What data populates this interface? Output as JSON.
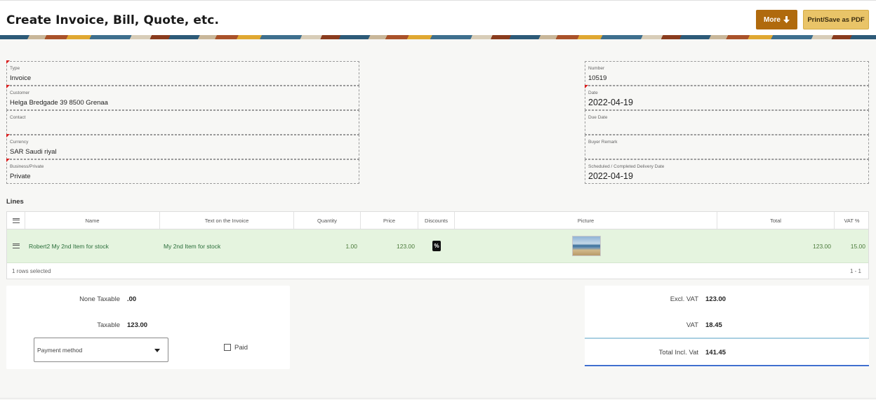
{
  "header": {
    "title": "Create Invoice, Bill, Quote, etc.",
    "more_label": "More",
    "pdf_label": "Print/Save as PDF"
  },
  "form_left": [
    {
      "label": "Type",
      "value": "Invoice",
      "required": true
    },
    {
      "label": "Customer",
      "value": "Helga Bredgade 39 8500 Grenaa",
      "required": true
    },
    {
      "label": "Contact",
      "value": "",
      "required": false
    },
    {
      "label": "Currency",
      "value": "SAR Saudi riyal",
      "required": true
    },
    {
      "label": "Business/Private",
      "value": "Private",
      "required": true
    }
  ],
  "form_right": [
    {
      "label": "Number",
      "value": "10519",
      "required": false
    },
    {
      "label": "Date",
      "value": "2022-04-19",
      "required": true
    },
    {
      "label": "Due Date",
      "value": "",
      "required": false
    },
    {
      "label": "Buyer Remark",
      "value": "",
      "required": false
    },
    {
      "label": "Scheduled / Completed Delivery Date",
      "value": "2022-04-19",
      "required": false
    }
  ],
  "lines": {
    "title": "Lines",
    "columns": [
      "Name",
      "Text on the Invoice",
      "Quantity",
      "Price",
      "Discounts",
      "Picture",
      "Total",
      "VAT %"
    ],
    "rows": [
      {
        "name": "Robert2 My 2nd Item for stock",
        "text": "My 2nd Item for stock",
        "quantity": "1.00",
        "price": "123.00",
        "discount_icon": "%",
        "total": "123.00",
        "vat": "15.00"
      }
    ],
    "selection_status": "1 rows selected",
    "pagination": "1 - 1"
  },
  "summary_left": {
    "none_taxable_label": "None Taxable",
    "none_taxable_value": ".00",
    "taxable_label": "Taxable",
    "taxable_value": "123.00",
    "payment_placeholder": "Payment method",
    "paid_label": "Paid"
  },
  "summary_right": {
    "excl_vat_label": "Excl. VAT",
    "excl_vat_value": "123.00",
    "vat_label": "VAT",
    "vat_value": "18.45",
    "total_label": "Total Incl. Vat",
    "total_value": "141.45"
  },
  "colors": {
    "more_button": "#b06a0d",
    "pdf_button": "#e9c468",
    "selected_row": "#e5f4df",
    "required_marker": "#d81e1e",
    "total_separator": "#3f6fce"
  },
  "icons": [
    "arrow-down-icon",
    "menu-icon",
    "percent-icon",
    "beach-photo-thumbnail",
    "caret-down-icon",
    "checkbox-icon"
  ]
}
